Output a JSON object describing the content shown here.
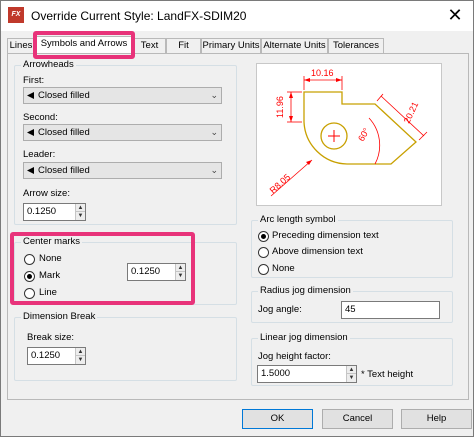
{
  "window": {
    "title": "Override Current Style: LandFX-SDIM20",
    "app_icon_text": "FX",
    "close_label": "✕"
  },
  "tabs": [
    {
      "label": "Lines"
    },
    {
      "label": "Symbols and Arrows",
      "active": true
    },
    {
      "label": "Text"
    },
    {
      "label": "Fit"
    },
    {
      "label": "Primary Units"
    },
    {
      "label": "Alternate Units"
    },
    {
      "label": "Tolerances"
    }
  ],
  "arrowheads": {
    "group_title": "Arrowheads",
    "first_label": "First:",
    "first_value": "Closed filled",
    "second_label": "Second:",
    "second_value": "Closed filled",
    "leader_label": "Leader:",
    "leader_value": "Closed filled",
    "arrow_size_label": "Arrow size:",
    "arrow_size_value": "0.1250"
  },
  "center_marks": {
    "group_title": "Center marks",
    "options": [
      "None",
      "Mark",
      "Line"
    ],
    "selected": "Mark",
    "size_value": "0.1250"
  },
  "dimension_break": {
    "group_title": "Dimension Break",
    "break_size_label": "Break size:",
    "break_size_value": "0.1250"
  },
  "arc_length": {
    "group_title": "Arc length symbol",
    "options": [
      "Preceding dimension text",
      "Above dimension text",
      "None"
    ],
    "selected": "Preceding dimension text"
  },
  "radius_jog": {
    "group_title": "Radius jog dimension",
    "jog_angle_label": "Jog angle:",
    "jog_angle_value": "45"
  },
  "linear_jog": {
    "group_title": "Linear jog dimension",
    "jog_height_label": "Jog height factor:",
    "jog_height_value": "1.5000",
    "jog_height_suffix": "* Text height"
  },
  "preview": {
    "dim_top": "10.16",
    "dim_left": "11.96",
    "dim_right": "20.21",
    "dim_angle": "60°",
    "dim_radius": "R8.05"
  },
  "buttons": {
    "ok": "OK",
    "cancel": "Cancel",
    "help": "Help"
  },
  "colors": {
    "highlight": "#e8337a",
    "dimension": "#ff0000",
    "geometry": "#c8a000"
  }
}
